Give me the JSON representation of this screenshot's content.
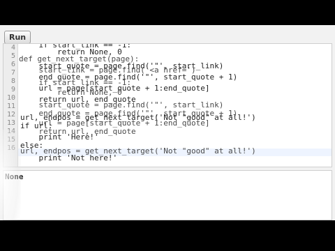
{
  "toolbar": {
    "run_label": "Run"
  },
  "gutter": [
    "4",
    "5",
    "6",
    "7",
    "8",
    "9",
    "10",
    "11",
    "12",
    "13",
    "14",
    "15",
    "16"
  ],
  "code_lines": [
    {
      "text": "    if start_link == -1:",
      "ghost": false
    },
    {
      "text": "        return None, 0",
      "ghost": false
    },
    {
      "text": "def get_next_target(page):",
      "ghost": true
    },
    {
      "text": "    start_quote = page.find('\"', start_link)",
      "ghost": false
    },
    {
      "text": "    start_link = page.find('<a href=')",
      "ghost": true
    },
    {
      "text": "    end_quote = page.find('\"', start_quote + 1)",
      "ghost": false
    },
    {
      "text": "    if start_link == -1:",
      "ghost": true
    },
    {
      "text": "    url = page[start_quote + 1:end_quote]",
      "ghost": false
    },
    {
      "text": "        return None, 0",
      "ghost": true
    },
    {
      "text": "    return url, end_quote",
      "ghost": false
    },
    {
      "text": "    start_quote = page.find('\"', start_link)",
      "ghost": true
    },
    {
      "text": "    end_quote = page.find('\"', start_quote + 1)",
      "ghost": true
    },
    {
      "text": "url, endpos = get_next_target('Not \"good\" at all!')",
      "ghost": false
    },
    {
      "text": "    url = page[start_quote + 1:end_quote]",
      "ghost": true
    },
    {
      "text": "if url:",
      "ghost": false
    },
    {
      "text": "    return url, end_quote",
      "ghost": true
    },
    {
      "text": "    print 'Here!'",
      "ghost": false
    },
    {
      "text": "else:",
      "ghost": false
    },
    {
      "text": "url, endpos = get_next_target('Not \"good\" at all!')",
      "ghost": true
    },
    {
      "text": "    print 'Not here!'",
      "ghost": false
    }
  ],
  "output": {
    "text": "None"
  }
}
